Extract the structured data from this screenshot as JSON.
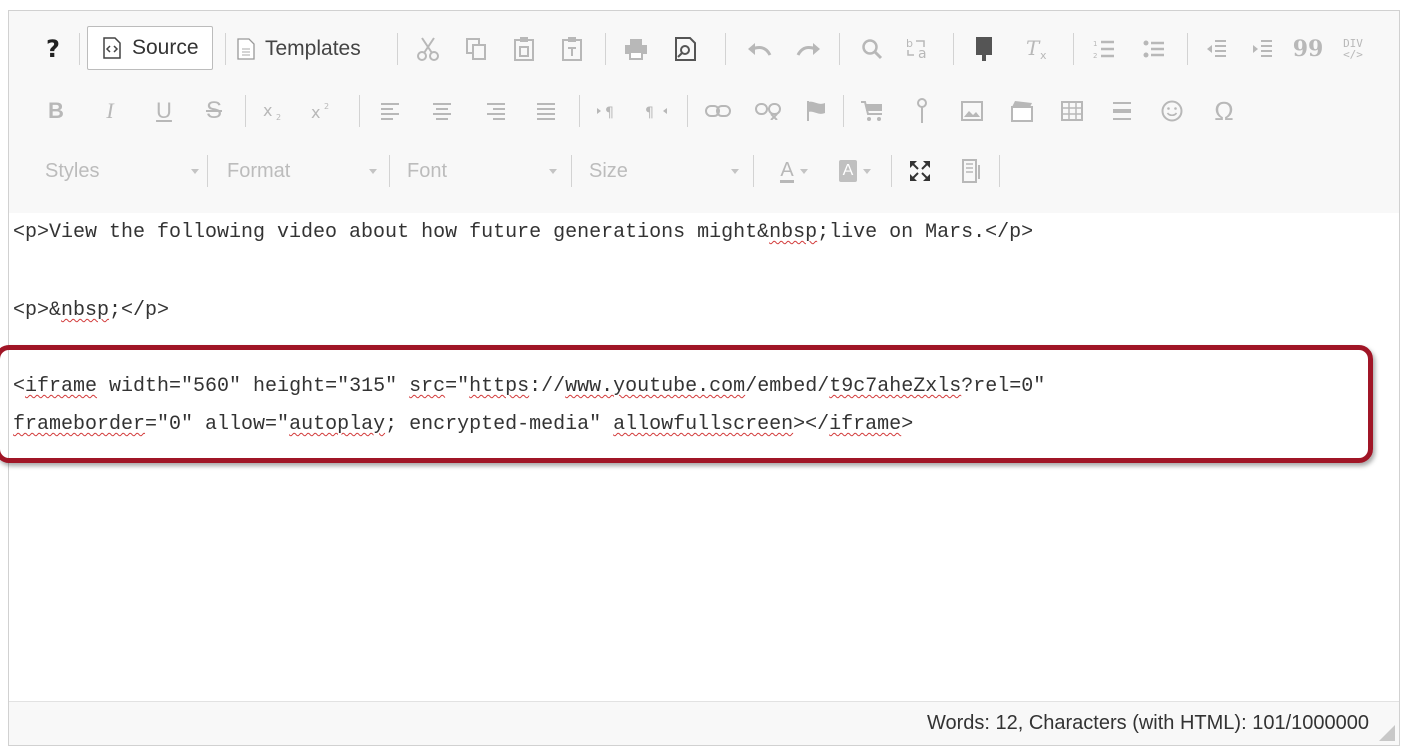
{
  "toolbar": {
    "help_label": "?",
    "source_label": "Source",
    "templates_label": "Templates",
    "quote_glyph": "99",
    "div_label_top": "DIV",
    "div_label_bottom": "</>",
    "bold": "B",
    "italic": "I",
    "underline": "U",
    "strike": "S",
    "omega": "Ω",
    "styles_label": "Styles",
    "format_label": "Format",
    "font_label": "Font",
    "size_label": "Size",
    "text_color_label": "A",
    "bg_color_label": "A"
  },
  "source": {
    "line1": "<p>View the following video about how future generations might&nbsp;live on Mars.</p>",
    "line2": "<p>&nbsp;</p>",
    "line3": "<iframe width=\"560\" height=\"315\" src=\"https://www.youtube.com/embed/t9c7aheZxls?rel=0\"",
    "line4": "frameborder=\"0\" allow=\"autoplay; encrypted-media\" allowfullscreen></iframe>"
  },
  "status": {
    "text": "Words: 12, Characters (with HTML): 101/1000000"
  },
  "colors": {
    "callout": "#a01526",
    "toolbar_bg": "#f8f8f8",
    "icon_disabled": "#b8b8b8"
  }
}
